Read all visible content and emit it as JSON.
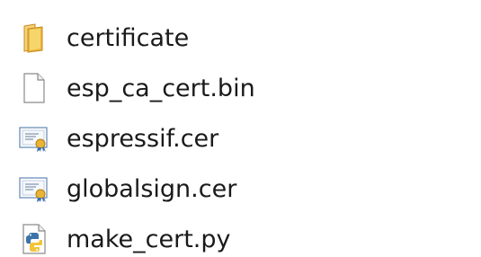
{
  "files": [
    {
      "name": "certificate",
      "icon": "folder-icon"
    },
    {
      "name": "esp_ca_cert.bin",
      "icon": "blank-file-icon"
    },
    {
      "name": "espressif.cer",
      "icon": "certificate-icon"
    },
    {
      "name": "globalsign.cer",
      "icon": "certificate-icon"
    },
    {
      "name": "make_cert.py",
      "icon": "python-file-icon"
    }
  ],
  "colors": {
    "folder": "#e8b642",
    "folder_dark": "#c98a1a",
    "certificate_blue": "#3a6fb0",
    "python_blue": "#3d73a8",
    "python_yellow": "#f2c43a"
  }
}
